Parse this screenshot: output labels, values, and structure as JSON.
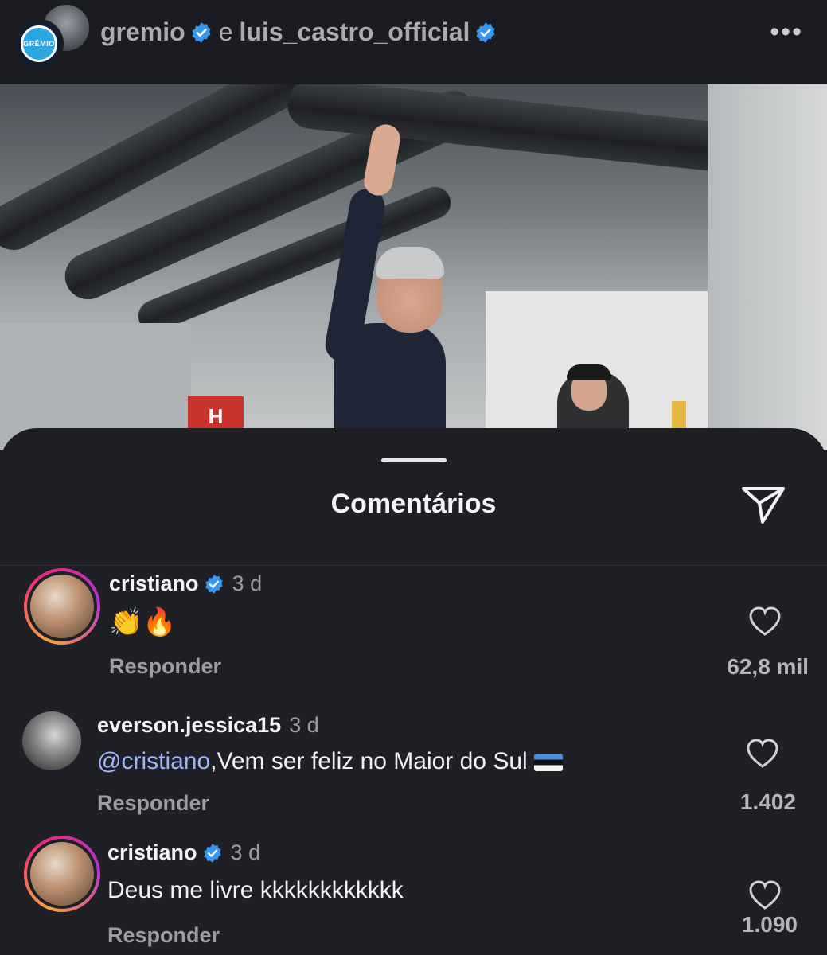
{
  "header": {
    "account_primary": "gremio",
    "conjunction": "e",
    "account_secondary": "luis_castro_official",
    "more_icon": "more-horizontal-icon",
    "badge_text": "GRÊMIO"
  },
  "photo": {
    "sign_letter": "H"
  },
  "sheet": {
    "title": "Comentários",
    "share_icon": "send-icon"
  },
  "comments": [
    {
      "username": "cristiano",
      "verified": true,
      "time": "3 d",
      "text": "👏🔥",
      "reply_label": "Responder",
      "likes": "62,8 mil"
    },
    {
      "username": "everson.jessica15",
      "verified": false,
      "time": "3 d",
      "mention": "@cristiano",
      "text": ",Vem ser feliz no Maior do Sul",
      "reply_label": "Responder",
      "likes": "1.402"
    },
    {
      "username": "cristiano",
      "verified": true,
      "time": "3 d",
      "text": "Deus me livre kkkkkkkkkkkk",
      "reply_label": "Responder",
      "likes": "1.090"
    }
  ],
  "colors": {
    "background": "#1f2025",
    "verified_blue": "#3897f0",
    "mention": "#9db7ff",
    "muted_text": "#9c9ea4"
  }
}
